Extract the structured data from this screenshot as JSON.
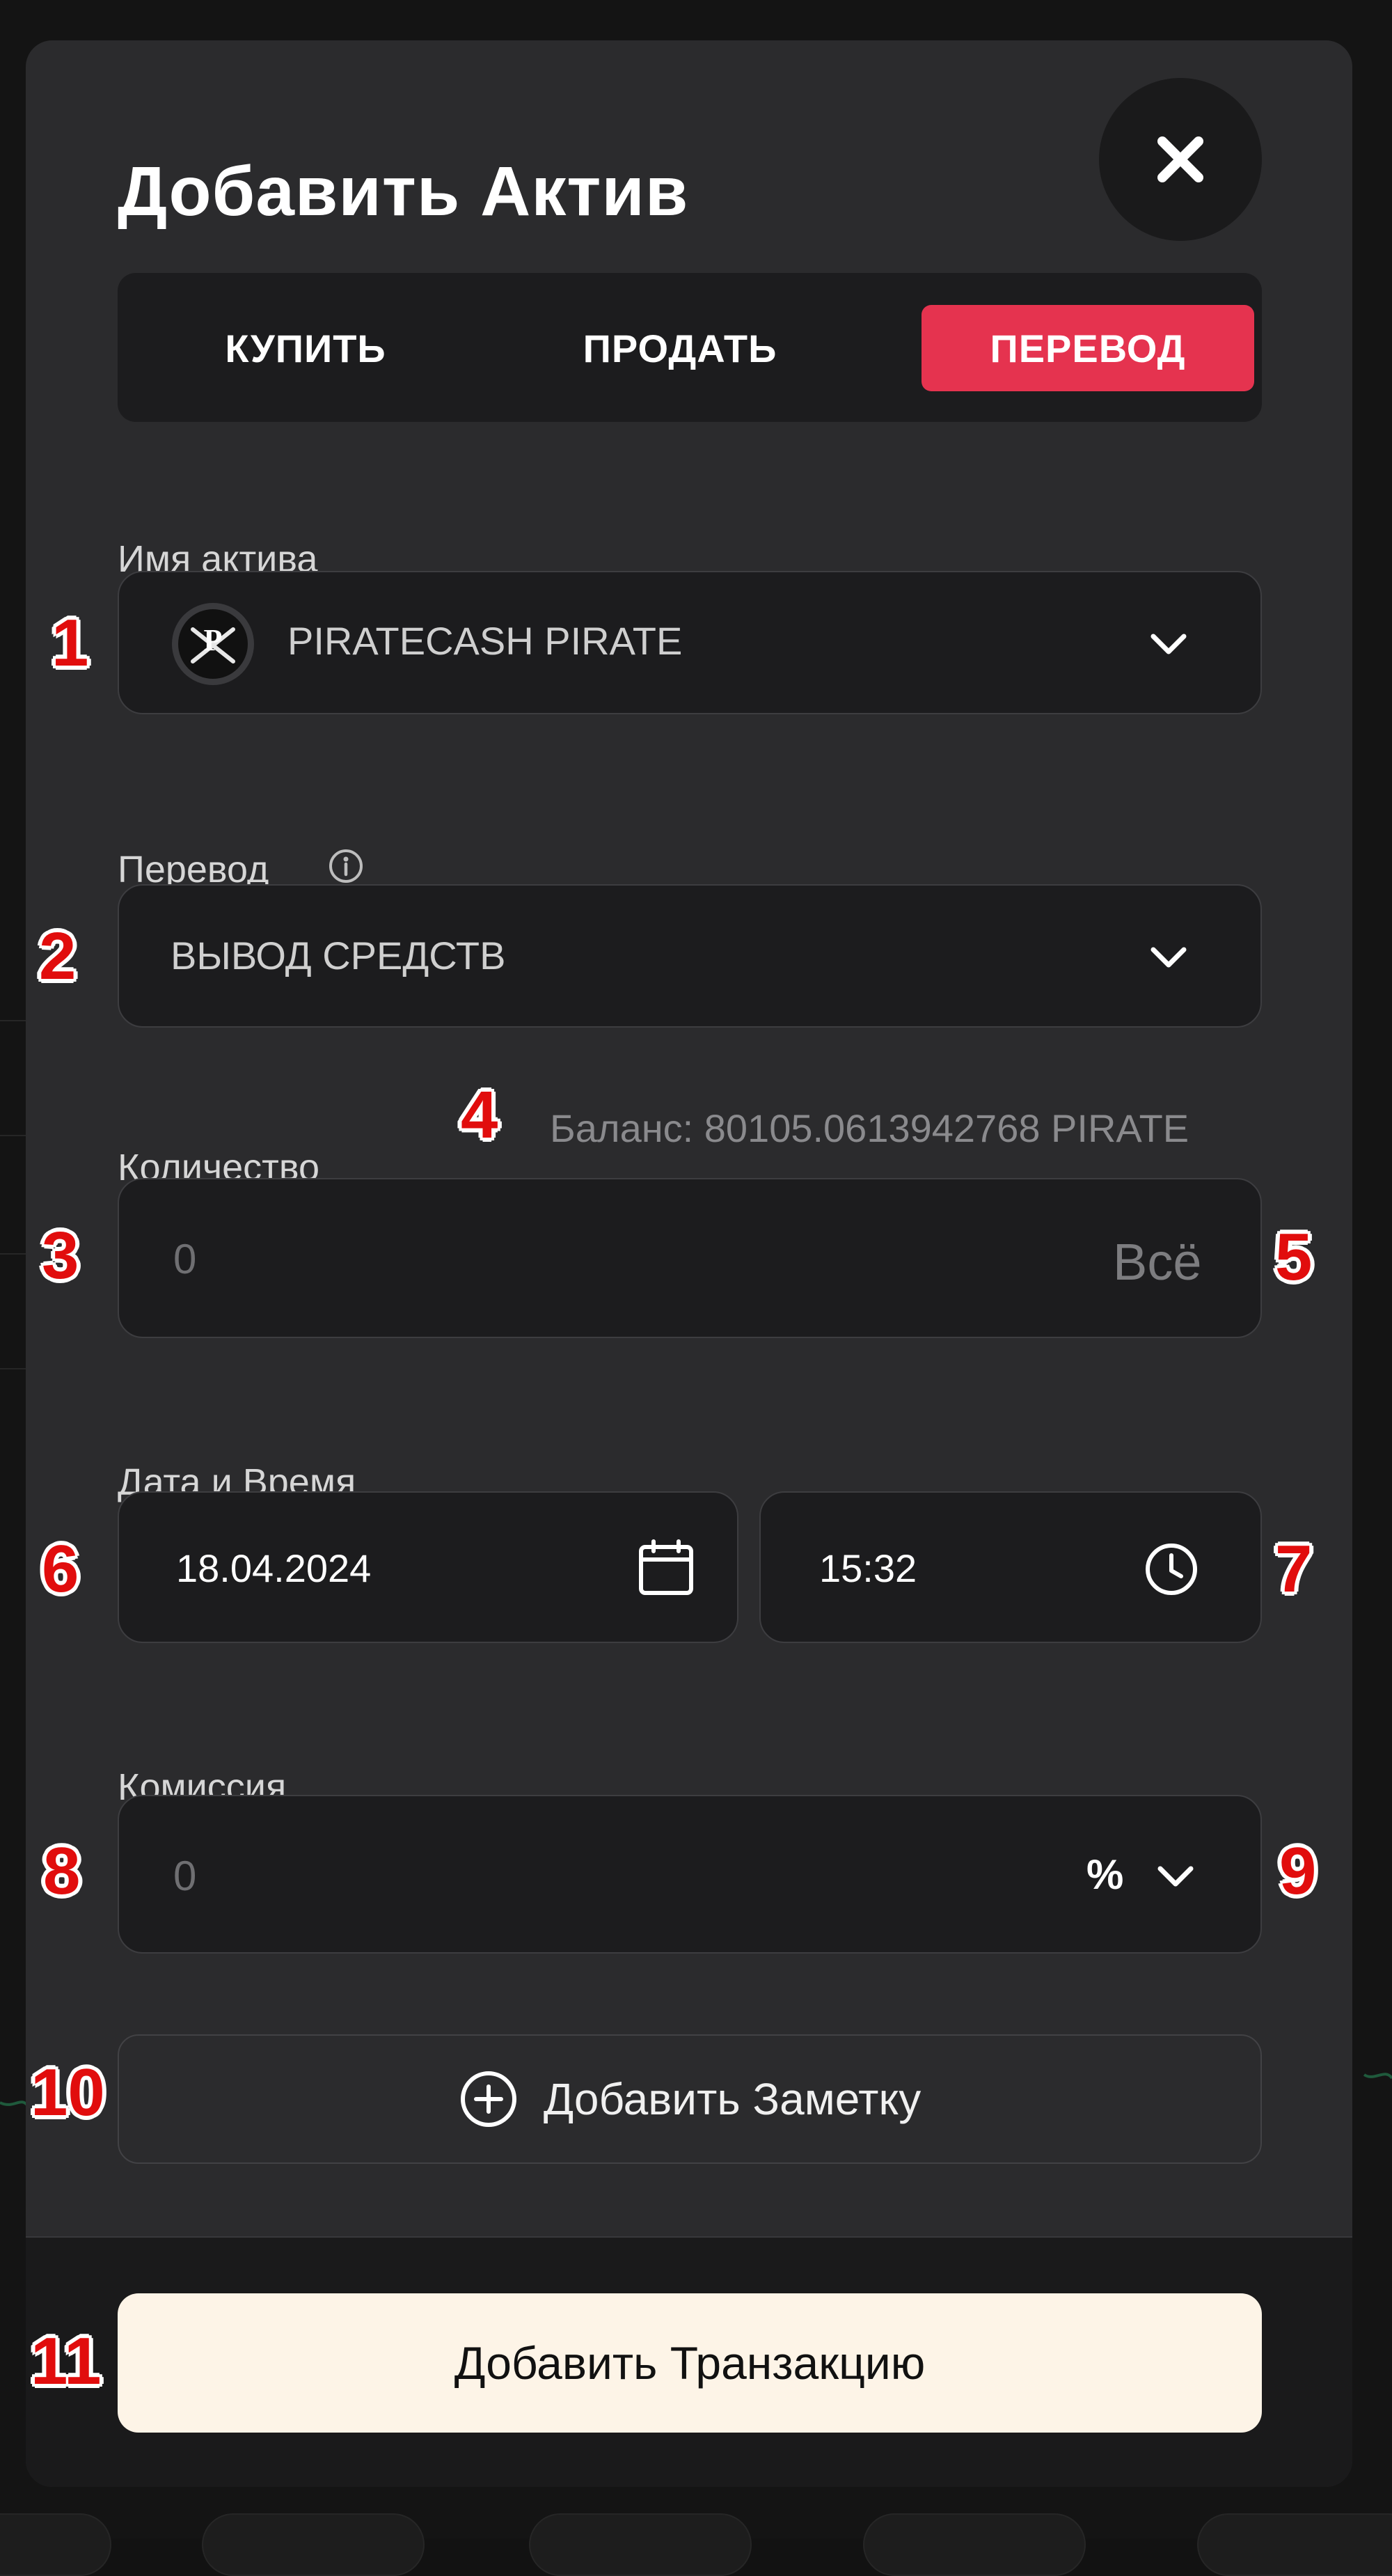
{
  "modal": {
    "title": "Добавить Актив",
    "tabs": [
      {
        "label": "КУПИТЬ",
        "active": false
      },
      {
        "label": "ПРОДАТЬ",
        "active": false
      },
      {
        "label": "ПЕРЕВОД",
        "active": true
      }
    ]
  },
  "asset": {
    "label": "Имя актива",
    "value": "PIRATECASH PIRATE",
    "icon": "piratecash-logo"
  },
  "transfer": {
    "label": "Перевод",
    "value": "ВЫВОД СРЕДСТВ"
  },
  "quantity": {
    "label": "Количество",
    "balance": "Баланс: 80105.0613942768 PIRATE",
    "placeholder": "0",
    "all_label": "Всё"
  },
  "datetime": {
    "label": "Дата и Время",
    "date": "18.04.2024",
    "time": "15:32"
  },
  "commission": {
    "label": "Комиссия",
    "placeholder": "0",
    "unit": "%"
  },
  "note_button": "Добавить Заметку",
  "submit_button": "Добавить Транзакцию",
  "annotations": [
    "1",
    "2",
    "3",
    "4",
    "5",
    "6",
    "7",
    "8",
    "9",
    "10",
    "11"
  ],
  "colors": {
    "accent": "#e5334f",
    "submit_bg": "#fdf4e7",
    "annotation": "#e10d0d"
  }
}
